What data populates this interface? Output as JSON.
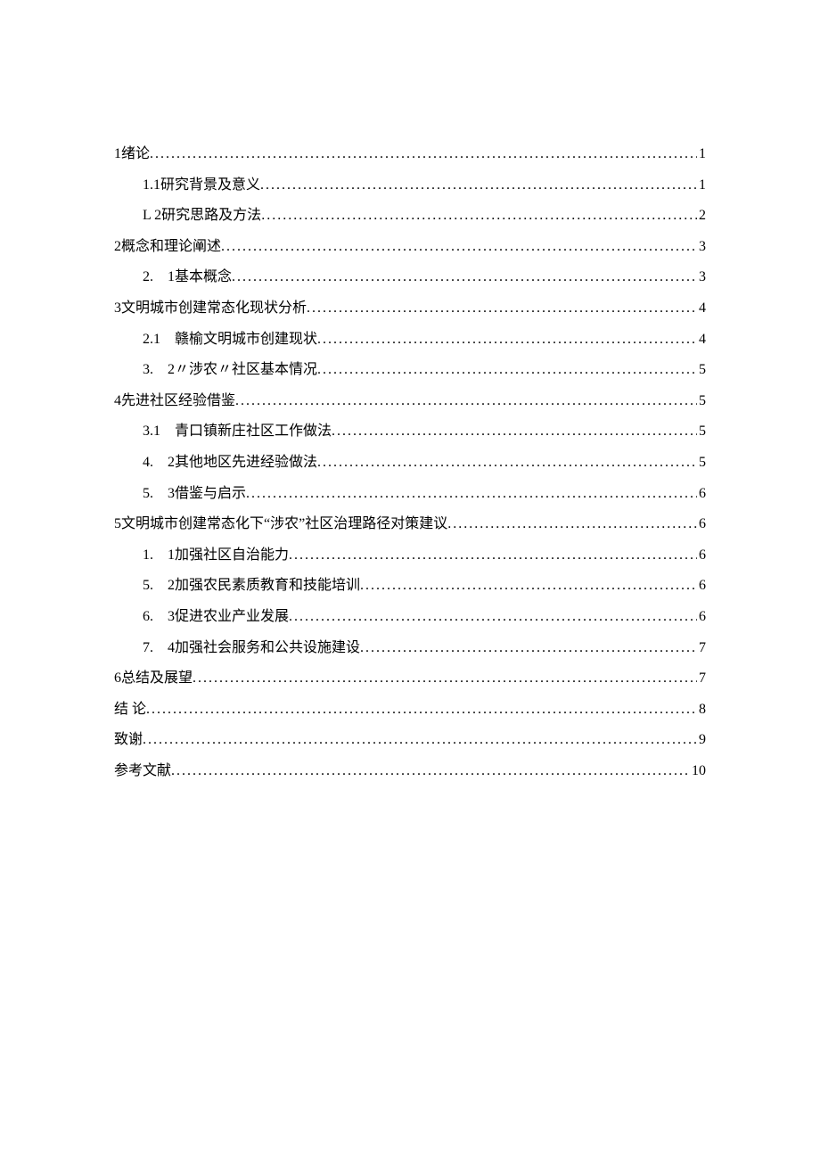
{
  "toc": [
    {
      "indent": 0,
      "label": "1绪论",
      "page": "1"
    },
    {
      "indent": 1,
      "label": "1.1研究背景及意义 ",
      "page": "1"
    },
    {
      "indent": 1,
      "label": "L 2研究思路及方法 ",
      "page": "2"
    },
    {
      "indent": 0,
      "label": "2概念和理论阐述",
      "page": "3"
    },
    {
      "indent": 1,
      "label": "2.　1基本概念",
      "page": "3"
    },
    {
      "indent": 0,
      "label": "3文明城市创建常态化现状分析",
      "page": "4"
    },
    {
      "indent": 1,
      "label": "2.1　赣榆文明城市创建现状 ",
      "page": "4"
    },
    {
      "indent": 1,
      "label": "3.　2〃涉农〃社区基本情况 ",
      "page": "5"
    },
    {
      "indent": 0,
      "label": "4先进社区经验借鉴",
      "page": "5"
    },
    {
      "indent": 1,
      "label": "3.1　青口镇新庄社区工作做法 ",
      "page": "5"
    },
    {
      "indent": 1,
      "label": "4.　2其他地区先进经验做法",
      "page": "5"
    },
    {
      "indent": 1,
      "label": "5.　3借鉴与启示",
      "page": "6"
    },
    {
      "indent": 0,
      "label": "5文明城市创建常态化下“涉农”社区治理路径对策建议",
      "page": "6"
    },
    {
      "indent": 1,
      "label": "1.　1加强社区自治能力",
      "page": "6"
    },
    {
      "indent": 1,
      "label": "5.　2加强农民素质教育和技能培训",
      "page": "6"
    },
    {
      "indent": 1,
      "label": "6.　3促进农业产业发展",
      "page": "6"
    },
    {
      "indent": 1,
      "label": "7.　4加强社会服务和公共设施建设",
      "page": "7"
    },
    {
      "indent": 0,
      "label": "6总结及展望",
      "page": "7"
    },
    {
      "indent": 0,
      "label": "结 论",
      "page": "8"
    },
    {
      "indent": 0,
      "label": "致谢",
      "page": "9"
    },
    {
      "indent": 0,
      "label": "参考文献",
      "page": "10"
    }
  ]
}
